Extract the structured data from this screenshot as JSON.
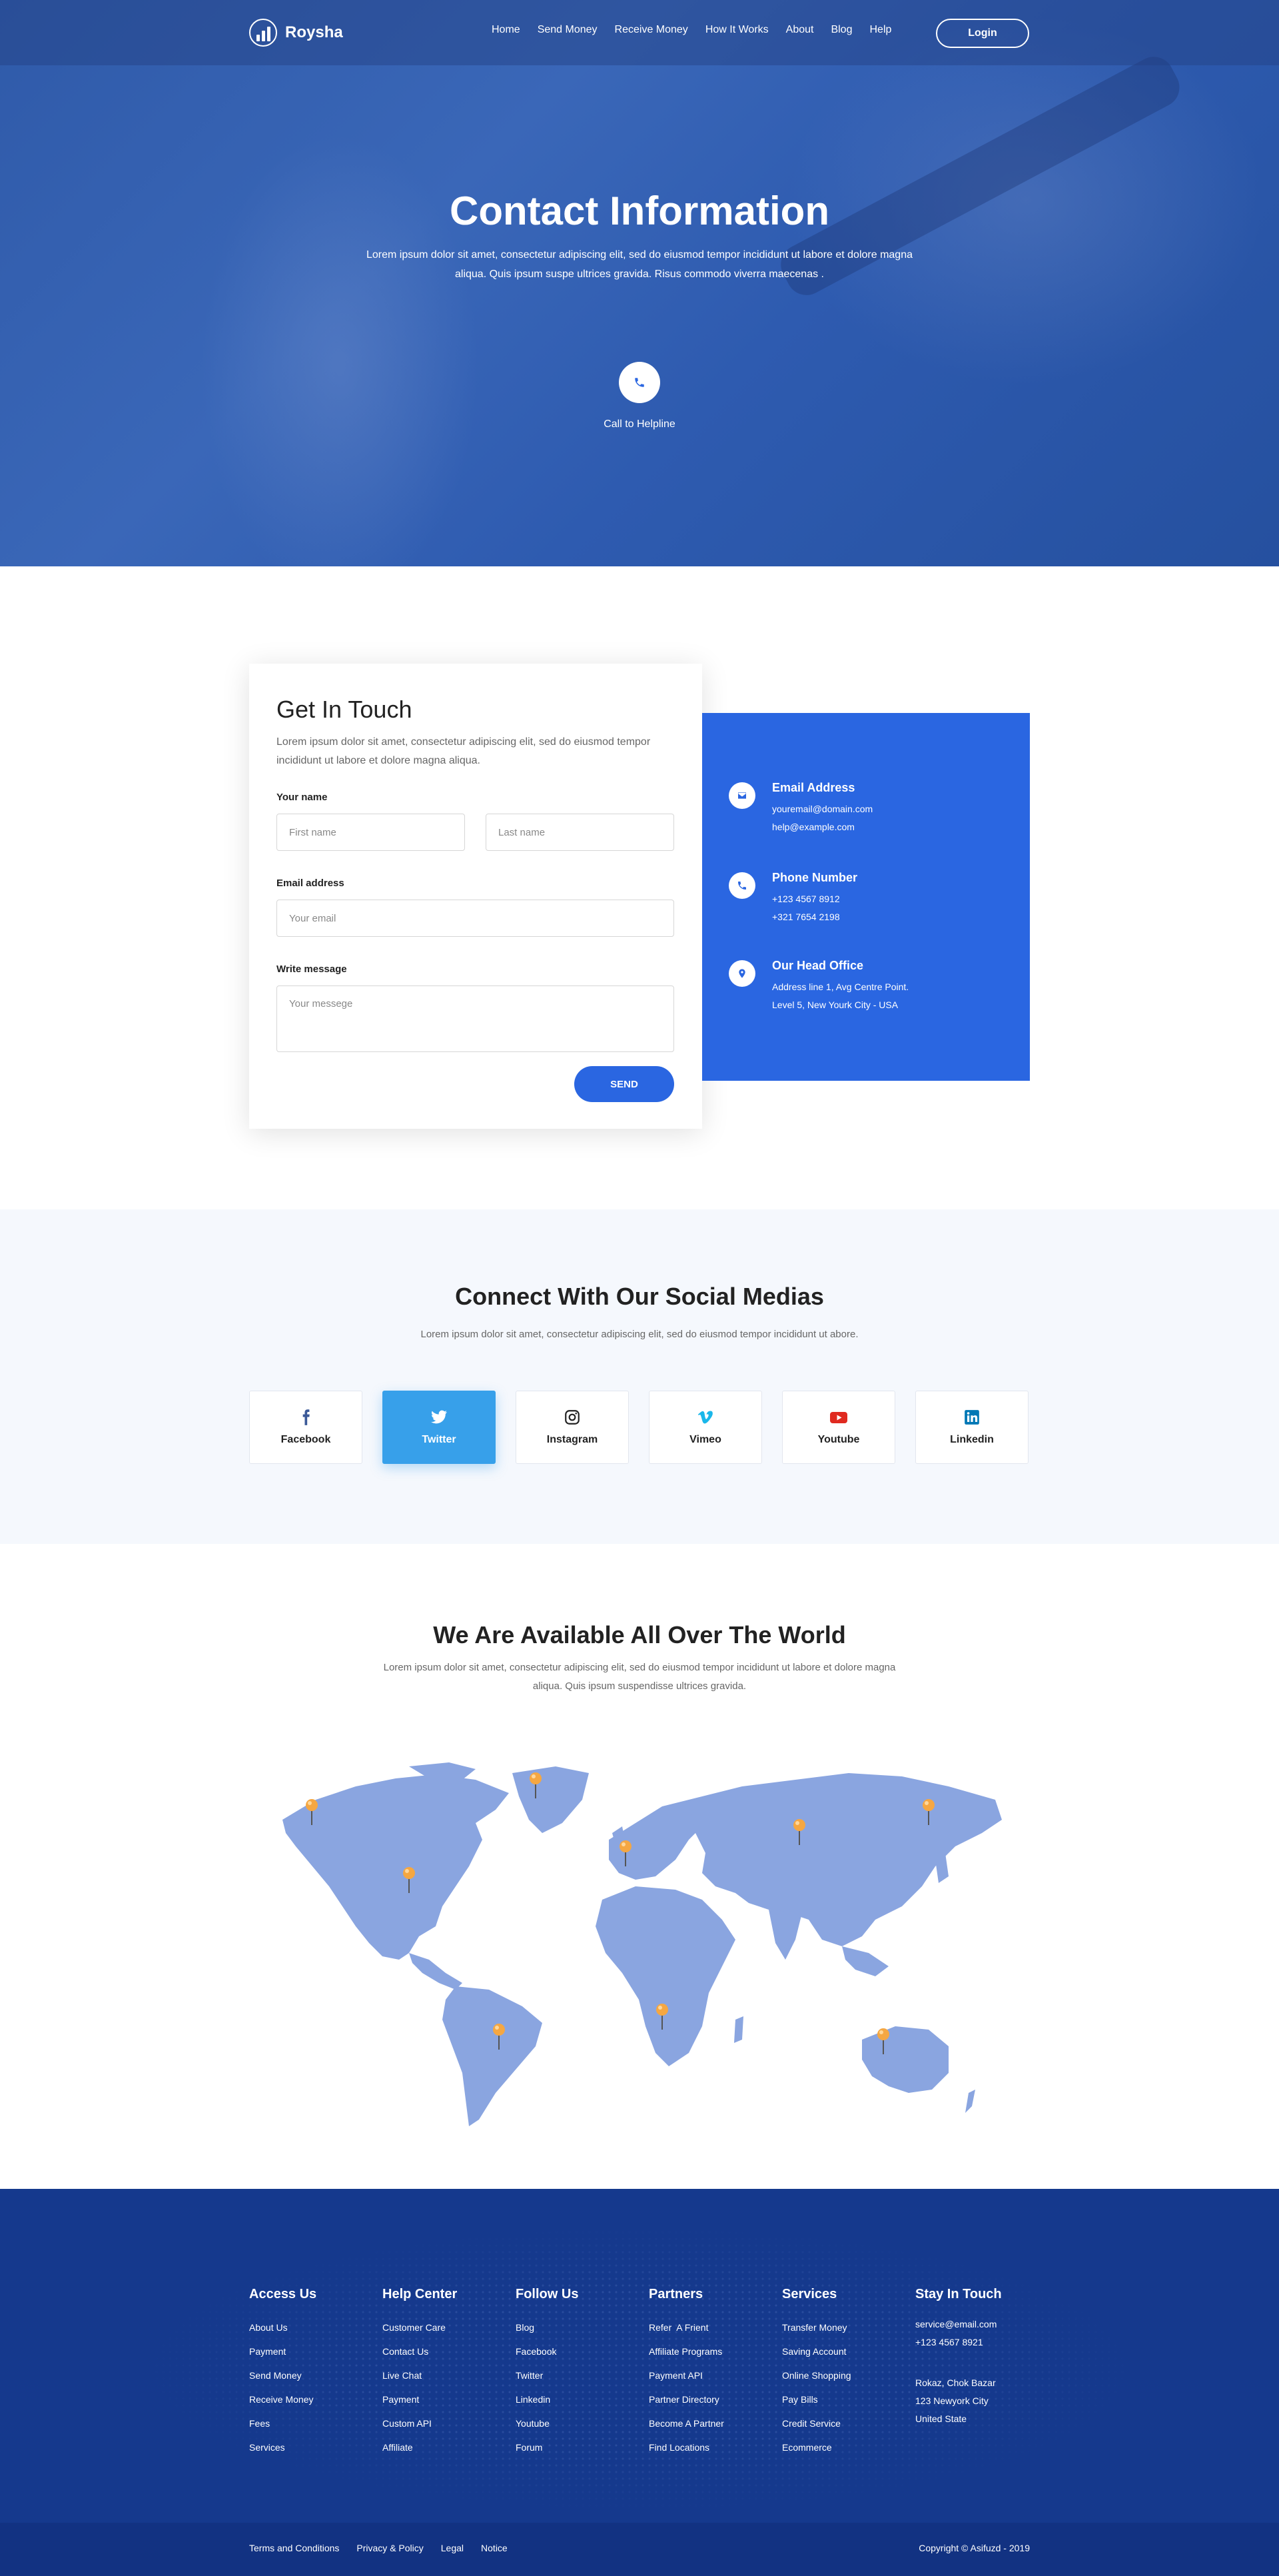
{
  "nav": {
    "brand": "Roysha",
    "links": [
      "Home",
      "Send Money",
      "Receive Money",
      "How It Works",
      "About",
      "Blog",
      "Help"
    ],
    "login": "Login"
  },
  "hero": {
    "title": "Contact Information",
    "subtitle": "Lorem ipsum dolor sit amet, consectetur adipiscing elit, sed do eiusmod tempor incididunt ut labore et dolore magna aliqua. Quis ipsum suspe ultrices gravida. Risus commodo viverra maecenas .",
    "call_label": "Call to Helpline"
  },
  "contact": {
    "title": "Get In Touch",
    "description": "Lorem ipsum dolor sit amet, consectetur adipiscing elit, sed do eiusmod tempor incididunt ut labore et dolore magna aliqua.",
    "name_label": "Your name",
    "first_name_placeholder": "First name",
    "last_name_placeholder": "Last name",
    "email_label": "Email address",
    "email_placeholder": "Your email",
    "message_label": "Write message",
    "message_placeholder": "Your messege",
    "send": "SEND",
    "info": {
      "email_title": "Email Address",
      "email_1": "youremail@domain.com",
      "email_2": "help@example.com",
      "phone_title": "Phone Number",
      "phone_1": "+123 4567 8912",
      "phone_2": "+321 7654 2198",
      "office_title": "Our Head Office",
      "office_1": "Address line 1, Avg Centre Point.",
      "office_2": "Level 5, New Yourk City - USA"
    }
  },
  "social": {
    "title": "Connect With Our Social Medias",
    "description": "Lorem ipsum dolor sit amet, consectetur adipiscing elit, sed do eiusmod tempor incididunt ut abore.",
    "cards": [
      {
        "label": "Facebook",
        "icon": "facebook-icon",
        "color": "#3b5998"
      },
      {
        "label": "Twitter",
        "icon": "twitter-icon",
        "color": "#ffffff"
      },
      {
        "label": "Instagram",
        "icon": "instagram-icon",
        "color": "#222222"
      },
      {
        "label": "Vimeo",
        "icon": "vimeo-icon",
        "color": "#1ab7ea"
      },
      {
        "label": "Youtube",
        "icon": "youtube-icon",
        "color": "#e02a20"
      },
      {
        "label": "Linkedin",
        "icon": "linkedin-icon",
        "color": "#0077b5"
      }
    ]
  },
  "world": {
    "title": "We Are Available All Over The World",
    "description": "Lorem ipsum dolor sit amet, consectetur adipiscing elit, sed do eiusmod tempor incididunt ut labore et dolore magna aliqua. Quis ipsum suspendisse ultrices gravida."
  },
  "footer": {
    "columns": [
      {
        "title": "Access Us",
        "items": [
          "About Us",
          "Payment",
          "Send Money",
          "Receive Money",
          "Fees",
          "Services"
        ]
      },
      {
        "title": "Help Center",
        "items": [
          "Customer Care",
          "Contact Us",
          "Live Chat",
          "Payment",
          "Custom API",
          "Affiliate"
        ]
      },
      {
        "title": "Follow Us",
        "items": [
          "Blog",
          "Facebook",
          "Twitter",
          "Linkedin",
          "Youtube",
          "Forum"
        ]
      },
      {
        "title": "Partners",
        "items": [
          "Refer  A Frient",
          "Affiliate Programs",
          "Payment API",
          "Partner Directory",
          "Become A Partner",
          "Find Locations"
        ]
      },
      {
        "title": "Services",
        "items": [
          "Transfer Money",
          "Saving Account",
          "Online Shopping",
          "Pay Bills",
          "Credit Service",
          "Ecommerce"
        ]
      }
    ],
    "contact": {
      "title": "Stay In Touch",
      "email": "service@email.com",
      "phone": "+123 4567 8921",
      "address_1": "Rokaz, Chok Bazar",
      "address_2": "123 Newyork City",
      "address_3": "United State"
    },
    "bottom_links": [
      "Terms and Conditions",
      "Privacy & Policy",
      "Legal",
      "Notice"
    ],
    "copyright": "Copyright © Asifuzd - 2019"
  },
  "colors": {
    "primary": "#2a66e1",
    "hero": "#2f5aa9",
    "footer": "#15398d",
    "map": "#8aa5e0",
    "pin": "#f5a742"
  }
}
